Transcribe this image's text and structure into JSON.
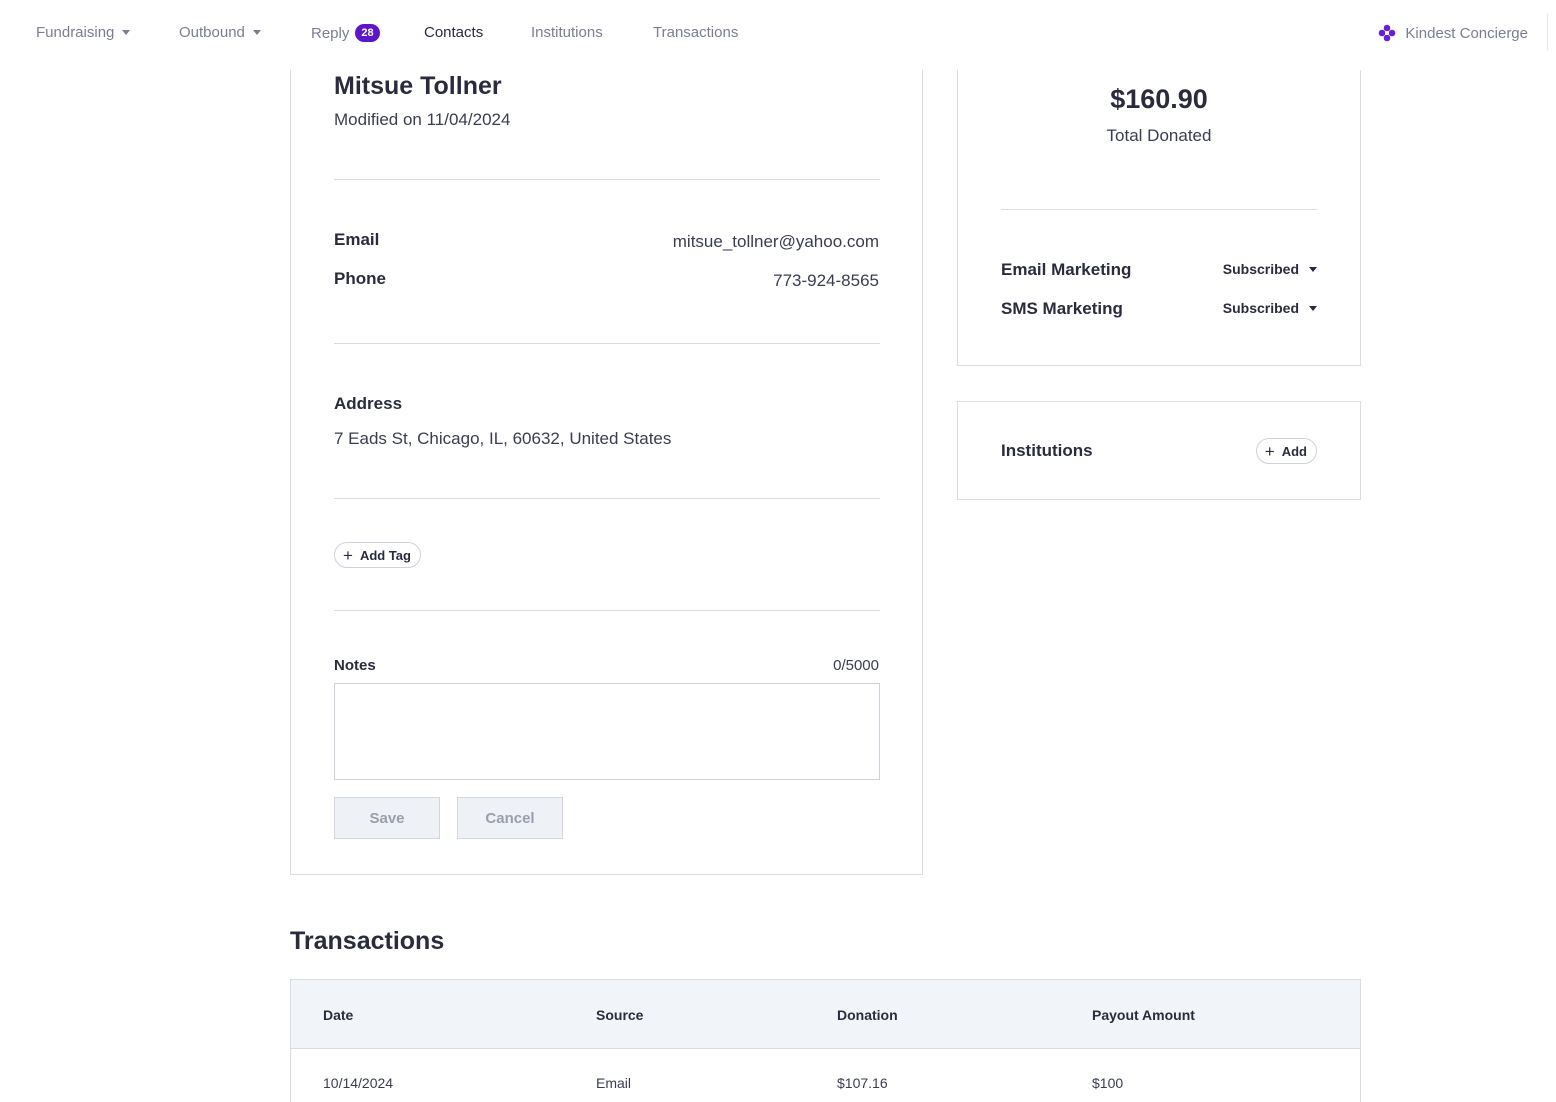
{
  "nav": {
    "fundraising": "Fundraising",
    "outbound": "Outbound",
    "reply": "Reply",
    "reply_badge": "28",
    "contacts": "Contacts",
    "institutions": "Institutions",
    "transactions": "Transactions",
    "brand": "Kindest Concierge",
    "brand_color": "#6a1fd6",
    "badge_color": "#5b16c9"
  },
  "contact": {
    "name": "Mitsue Tollner",
    "modified": "Modified on 11/04/2024",
    "email_label": "Email",
    "email": "mitsue_tollner@yahoo.com",
    "phone_label": "Phone",
    "phone": "773-924-8565",
    "address_label": "Address",
    "address": "7 Eads St, Chicago, IL, 60632, United States",
    "add_tag": "Add Tag",
    "notes_label": "Notes",
    "notes_count": "0/5000",
    "notes_value": "",
    "save": "Save",
    "cancel": "Cancel"
  },
  "summary": {
    "total": "$160.90",
    "total_label": "Total Donated",
    "email_marketing_label": "Email Marketing",
    "email_marketing_value": "Subscribed",
    "sms_marketing_label": "SMS Marketing",
    "sms_marketing_value": "Subscribed"
  },
  "institutions": {
    "label": "Institutions",
    "add": "Add"
  },
  "transactions": {
    "title": "Transactions",
    "columns": [
      "Date",
      "Source",
      "Donation",
      "Payout Amount"
    ],
    "rows": [
      [
        "10/14/2024",
        "Email",
        "$107.16",
        "$100"
      ]
    ]
  }
}
